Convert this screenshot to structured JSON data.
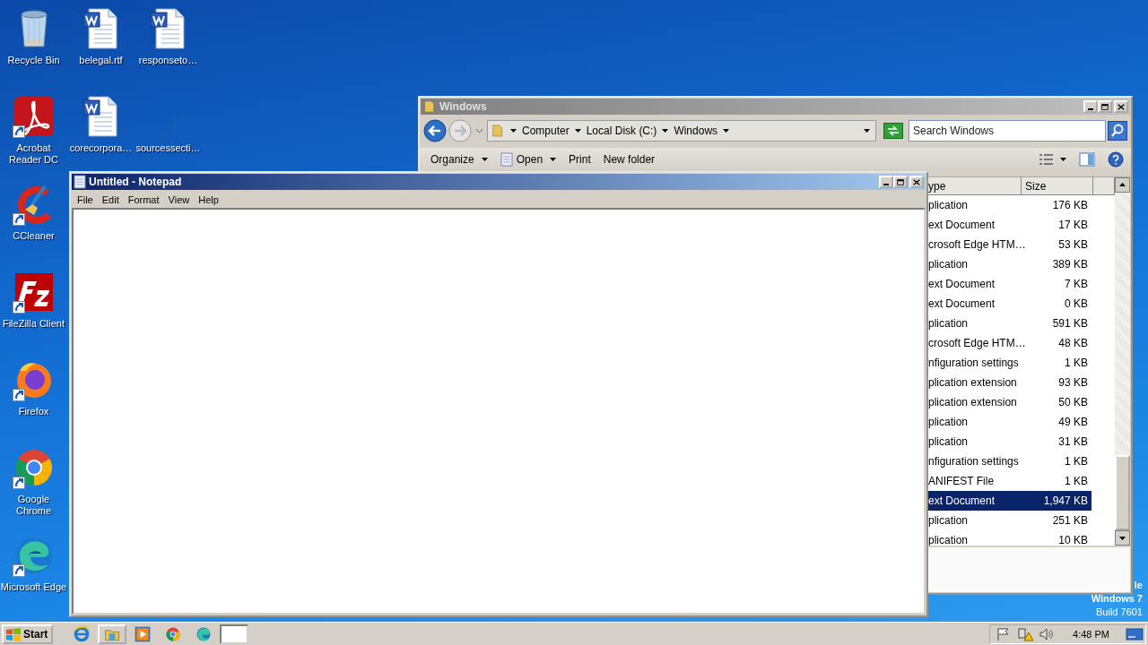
{
  "desktop_icons": [
    {
      "label": "Recycle Bin",
      "kind": "recycle",
      "shortcut": false
    },
    {
      "label": "belegal.rtf",
      "kind": "word",
      "shortcut": false
    },
    {
      "label": "responseto…",
      "kind": "word",
      "shortcut": false
    },
    {
      "label": "Acrobat Reader DC",
      "kind": "acrobat",
      "shortcut": true
    },
    {
      "label": "corecorpora…",
      "kind": "word",
      "shortcut": false
    },
    {
      "label": "sourcessecti…",
      "kind": "blank",
      "shortcut": false
    },
    {
      "label": "CCleaner",
      "kind": "ccleaner",
      "shortcut": true
    },
    {
      "label": "FileZilla Client",
      "kind": "filezilla",
      "shortcut": true
    },
    {
      "label": "Firefox",
      "kind": "firefox",
      "shortcut": true
    },
    {
      "label": "Google Chrome",
      "kind": "chrome",
      "shortcut": true
    },
    {
      "label": "Microsoft Edge",
      "kind": "edge",
      "shortcut": true
    }
  ],
  "explorer": {
    "title": "Windows",
    "breadcrumb": [
      "Computer",
      "Local Disk (C:)",
      "Windows"
    ],
    "search": {
      "placeholder": "Search Windows"
    },
    "toolbar": [
      {
        "label": "Organize",
        "kind": "dropdown"
      },
      {
        "label": "Open",
        "kind": "open"
      },
      {
        "label": "Print",
        "kind": "plain"
      },
      {
        "label": "New folder",
        "kind": "plain"
      }
    ],
    "columns": [
      "ype",
      "Size"
    ],
    "rows": [
      {
        "type": "plication",
        "size": "176 KB",
        "selected": false
      },
      {
        "type": "ext Document",
        "size": "17 KB",
        "selected": false
      },
      {
        "type": "crosoft Edge HTM…",
        "size": "53 KB",
        "selected": false
      },
      {
        "type": "plication",
        "size": "389 KB",
        "selected": false
      },
      {
        "type": "ext Document",
        "size": "7 KB",
        "selected": false
      },
      {
        "type": "ext Document",
        "size": "0 KB",
        "selected": false
      },
      {
        "type": "plication",
        "size": "591 KB",
        "selected": false
      },
      {
        "type": "crosoft Edge HTM…",
        "size": "48 KB",
        "selected": false
      },
      {
        "type": "nfiguration settings",
        "size": "1 KB",
        "selected": false
      },
      {
        "type": "plication extension",
        "size": "93 KB",
        "selected": false
      },
      {
        "type": "plication extension",
        "size": "50 KB",
        "selected": false
      },
      {
        "type": "plication",
        "size": "49 KB",
        "selected": false
      },
      {
        "type": "plication",
        "size": "31 KB",
        "selected": false
      },
      {
        "type": "nfiguration settings",
        "size": "1 KB",
        "selected": false
      },
      {
        "type": "ANIFEST File",
        "size": "1 KB",
        "selected": false
      },
      {
        "type": "ext Document",
        "size": "1,947 KB",
        "selected": true
      },
      {
        "type": "plication",
        "size": "251 KB",
        "selected": false
      },
      {
        "type": "plication",
        "size": "10 KB",
        "selected": false
      }
    ]
  },
  "notepad": {
    "title": "Untitled - Notepad",
    "menu": [
      "File",
      "Edit",
      "Format",
      "View",
      "Help"
    ]
  },
  "desktop_version_text": [
    {
      "text": "le",
      "bold": true
    },
    {
      "text": "Windows 7",
      "bold": true
    },
    {
      "text": "Build 7601",
      "bold": false
    }
  ],
  "taskbar": {
    "start": "Start",
    "apps": [
      {
        "kind": "ie",
        "active": false
      },
      {
        "kind": "explorer",
        "active": true
      },
      {
        "kind": "media",
        "active": false
      },
      {
        "kind": "chrome",
        "active": false
      },
      {
        "kind": "edge",
        "active": false
      },
      {
        "kind": "blank",
        "active": false
      }
    ],
    "clock": "4:48 PM"
  }
}
